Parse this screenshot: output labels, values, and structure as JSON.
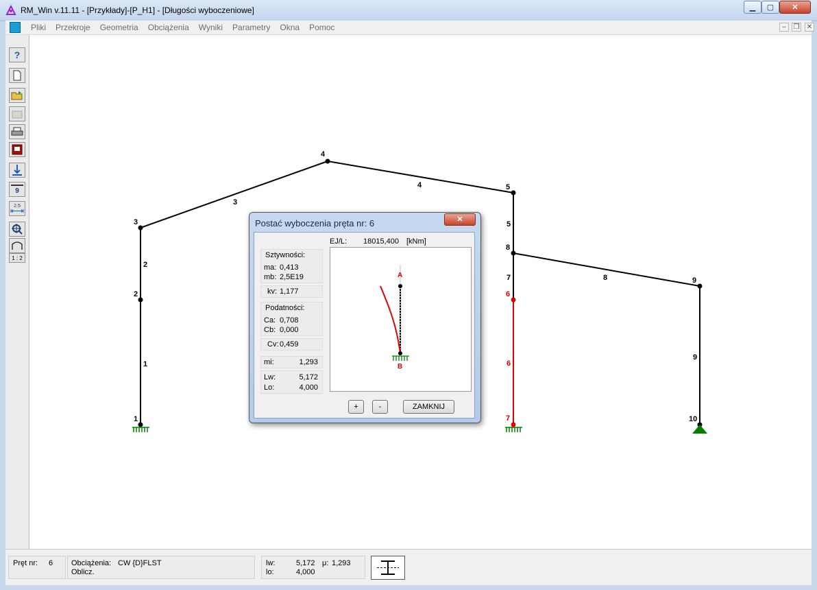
{
  "window": {
    "title": "RM_Win v.11.11 - [Przykłady]-[P_H1] - [Długości wyboczeniowe]"
  },
  "menu": {
    "items": [
      "Pliki",
      "Przekroje",
      "Geometria",
      "Obciążenia",
      "Wyniki",
      "Parametry",
      "Okna",
      "Pomoc"
    ]
  },
  "toolbar": {
    "number_label": "9",
    "dim_label": "2.5",
    "scale_label": "1 : 2",
    "help_label": "?"
  },
  "frame": {
    "nodes": [
      "1",
      "2",
      "3",
      "4",
      "5",
      "6",
      "7",
      "8",
      "9",
      "10"
    ],
    "bars": [
      "1",
      "2",
      "3",
      "4",
      "5",
      "6",
      "7",
      "8",
      "9"
    ],
    "highlight_color": "#e00000",
    "support_color": "#008000"
  },
  "dialog": {
    "title": "Postać wyboczenia pręta nr: 6",
    "stiffness_header": "Sztywności:",
    "ma_label": "ma:",
    "ma_value": "0,413",
    "mb_label": "mb:",
    "mb_value": "2,5E19",
    "kv_label": "kv:",
    "kv_value": "1,177",
    "compliance_header": "Podatności:",
    "ca_label": "Ca:",
    "ca_value": "0,708",
    "cb_label": "Cb:",
    "cb_value": "0,000",
    "cv_label": "Cv:",
    "cv_value": "0,459",
    "mi_label": "mi:",
    "mi_value": "1,293",
    "lw_label": "Lw:",
    "lw_value": "5,172",
    "lo_label": "Lo:",
    "lo_value": "4,000",
    "ejl_label": "EJ/L:",
    "ejl_value": "18015,400",
    "ejl_unit": "[kNm]",
    "point_a": "A",
    "point_b": "B",
    "plus_label": "+",
    "minus_label": "-",
    "close_label": "ZAMKNIJ"
  },
  "status": {
    "bar_label": "Pręt nr:",
    "bar_value": "6",
    "loads_label": "Obciążenia:",
    "loads_value": "CW {D}FLST",
    "calc_label": "Oblicz.",
    "lw_label": "lw:",
    "lw_value": "5,172",
    "mu_label": "μ:",
    "mu_value": "1,293",
    "lo_label": "lo:",
    "lo_value": "4,000"
  }
}
